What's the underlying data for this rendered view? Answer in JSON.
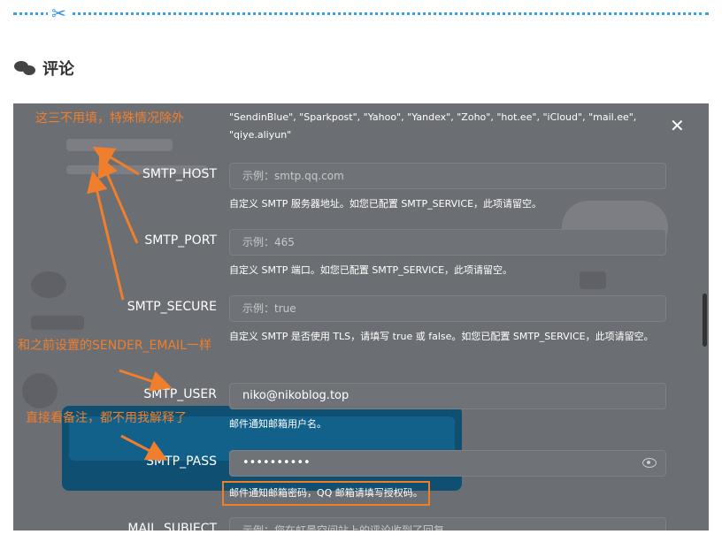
{
  "page": {
    "scissors_glyph": "✂",
    "comments_title": "评论"
  },
  "dialog": {
    "close_glyph": "✕",
    "service_list_note": "\"SendinBlue\", \"Sparkpost\", \"Yahoo\", \"Yandex\", \"Zoho\", \"hot.ee\", \"iCloud\", \"mail.ee\", \"qiye.aliyun\"",
    "fields": [
      {
        "label": "SMTP_HOST",
        "placeholder": "示例：smtp.qq.com",
        "value": "",
        "help": "自定义 SMTP 服务器地址。如您已配置 SMTP_SERVICE，此项请留空。"
      },
      {
        "label": "SMTP_PORT",
        "placeholder": "示例：465",
        "value": "",
        "help": "自定义 SMTP 端口。如您已配置 SMTP_SERVICE，此项请留空。"
      },
      {
        "label": "SMTP_SECURE",
        "placeholder": "示例：true",
        "value": "",
        "help": "自定义 SMTP 是否使用 TLS，请填写 true 或 false。如您已配置 SMTP_SERVICE，此项请留空。"
      },
      {
        "label": "SMTP_USER",
        "placeholder": "",
        "value": "niko@nikoblog.top",
        "help": "邮件通知邮箱用户名。"
      },
      {
        "label": "SMTP_PASS",
        "placeholder": "",
        "value": "••••••••••",
        "help": "邮件通知邮箱密码，QQ 邮箱请填写授权码。"
      },
      {
        "label": "MAIL_SUBJECT",
        "placeholder": "示例：您在虹景空间站上的评论收到了回复",
        "value": "",
        "help": ""
      }
    ]
  },
  "annotations": {
    "note1": "这三不用填，特殊情况除外",
    "note2": "和之前设置的SENDER_EMAIL一样",
    "note3": "直接看备注，都不用我解释了"
  },
  "colors": {
    "annotation": "#f07f2d",
    "divider": "#3aa0e0",
    "overlay": "#6b6e72"
  },
  "icons": [
    "scissors-icon",
    "chat-icon",
    "close-icon",
    "eye-icon"
  ]
}
